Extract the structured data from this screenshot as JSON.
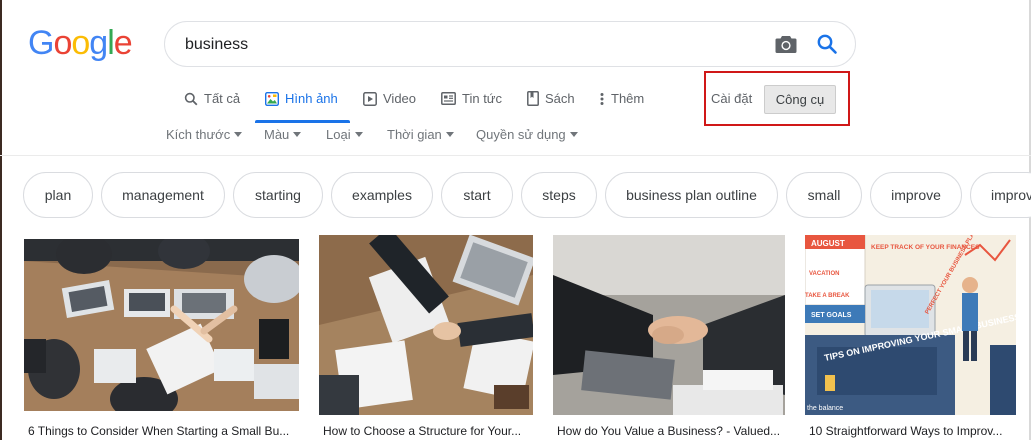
{
  "logo": {
    "letters": [
      "G",
      "o",
      "o",
      "g",
      "l",
      "e"
    ]
  },
  "search": {
    "query": "business"
  },
  "icons": {
    "camera": "camera-icon",
    "search": "search-icon"
  },
  "tabs": [
    {
      "label": "Tất cả",
      "icon": "search-icon"
    },
    {
      "label": "Hình ảnh",
      "icon": "image-icon",
      "active": true
    },
    {
      "label": "Video",
      "icon": "video-icon"
    },
    {
      "label": "Tin tức",
      "icon": "news-icon"
    },
    {
      "label": "Sách",
      "icon": "book-icon"
    },
    {
      "label": "Thêm",
      "icon": "more-vert-icon"
    }
  ],
  "settings_label": "Cài đặt",
  "tools_label": "Công cụ",
  "filters": [
    "Kích thước",
    "Màu",
    "Loại",
    "Thời gian",
    "Quyền sử dụng"
  ],
  "chips": [
    "plan",
    "management",
    "starting",
    "examples",
    "start",
    "steps",
    "business plan outline",
    "small",
    "improve",
    "improv"
  ],
  "results": [
    {
      "caption": "6 Things to Consider When Starting a Small Bu..."
    },
    {
      "caption": "How to Choose a Structure for Your..."
    },
    {
      "caption": "How do You Value a Business? - Valued..."
    },
    {
      "caption": "10 Straightforward Ways to Improv..."
    }
  ],
  "illustration_text": {
    "month": "AUGUST",
    "vacation": "VACATION",
    "keep_track": "KEEP TRACK OF YOUR FINANCES",
    "take_break": "TAKE A BREAK",
    "set_goals": "SET GOALS",
    "perfect": "PERFECT YOUR BUSINESS PLAN",
    "tips": "TIPS ON IMPROVING YOUR SMALL BUSINESS",
    "brand": "the balance"
  },
  "colors": {
    "google_blue": "#4285f4",
    "google_red": "#ea4335",
    "google_yellow": "#fbbc05",
    "google_green": "#34a853",
    "active_tab": "#1a73e8",
    "highlight_box": "#d01818"
  }
}
